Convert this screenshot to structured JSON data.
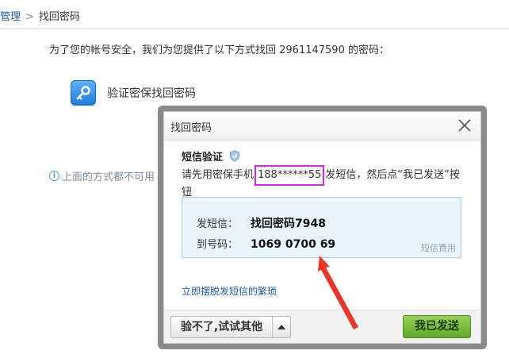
{
  "breadcrumb": {
    "parent": "管理",
    "separator": ">",
    "current": "找回密码"
  },
  "intro_text": "为了您的帐号安全，我们为您提供了以下方式找回 2961147590 的密码：",
  "method": {
    "label": "验证密保找回密码",
    "icon": "key-icon"
  },
  "other_hint": "上面的方式都不可用",
  "dialog": {
    "title": "找回密码",
    "sms_title": "短信验证",
    "instruction_prefix": "请先用密保手机",
    "phone": "188******55",
    "instruction_suffix": "发短信，然后点“我已发送”按钮",
    "sms_box": {
      "send_label": "发短信：",
      "send_value": "找回密码7948",
      "to_label": "到号码：",
      "to_value": "1069 0700 69",
      "fee_label": "短信费用"
    },
    "free_link": "立即摆脱发短信的繁琐",
    "try_other_label": "验不了,试试其他",
    "send_button_label": "我已发送"
  },
  "colors": {
    "link": "#1f5da6",
    "highlight_border": "#d52be0",
    "arrow": "#e8362b",
    "send_button": "#6cb433"
  }
}
